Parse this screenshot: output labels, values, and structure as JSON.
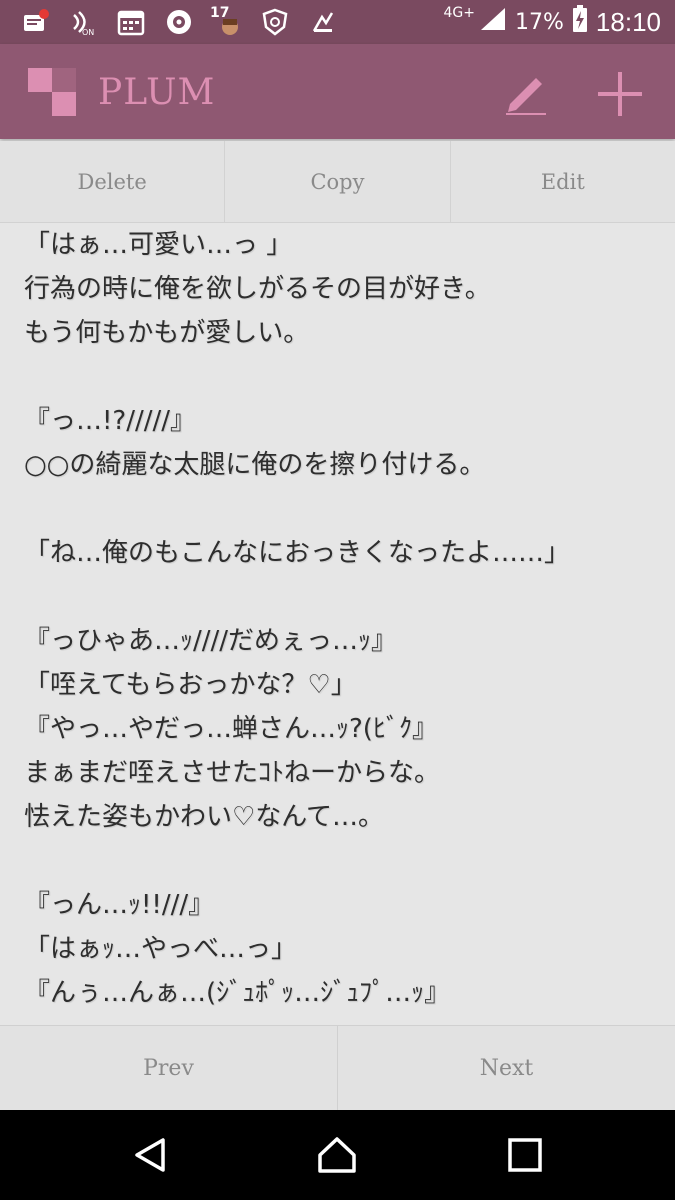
{
  "status_bar": {
    "notif_badge": "17",
    "network": "4G+",
    "battery": "17%",
    "time": "18:10",
    "icons": [
      "note-app-icon",
      "nfc-on-icon",
      "calendar-icon",
      "record-app-icon",
      "avatar-badge-icon",
      "shield-app-icon",
      "share-app-icon",
      "signal-icon",
      "battery-charging-icon"
    ]
  },
  "app_bar": {
    "title": "PLUM",
    "title_color": "#dc8fb2",
    "bar_color": "#8f5872",
    "actions": [
      "pencil-icon",
      "plus-icon"
    ]
  },
  "actions": {
    "delete": "Delete",
    "copy": "Copy",
    "edit": "Edit"
  },
  "content": {
    "lines": [
      "「はぁ…可愛い…っ 」",
      "行為の時に俺を欲しがるその目が好き。",
      "もう何もかもが愛しい。",
      "",
      "『っ…!?/////』",
      "○○の綺麗な太腿に俺のを擦り付ける。",
      "",
      "「ね…俺のもこんなにおっきくなったよ……」",
      "",
      "『っひゃあ…ｯ////だめぇっ…ｯ』",
      "「咥えてもらおっかな？♡」",
      "『やっ…やだっ…蝉さん…ｯ?(ﾋﾞｸ』",
      "まぁまだ咥えさせたｺﾄねーからな。",
      "怯えた姿もかわい♡なんて…。",
      "",
      "『っん…ｯ!!///』",
      "「はぁｯ…やっべ…っ」",
      "『んぅ…んぁ…(ｼﾞｭﾎﾟｯ…ｼﾞｭﾌﾟ…ｯ』"
    ]
  },
  "nav": {
    "prev": "Prev",
    "next": "Next"
  },
  "system_nav": [
    "back-icon",
    "home-icon",
    "recents-icon"
  ]
}
